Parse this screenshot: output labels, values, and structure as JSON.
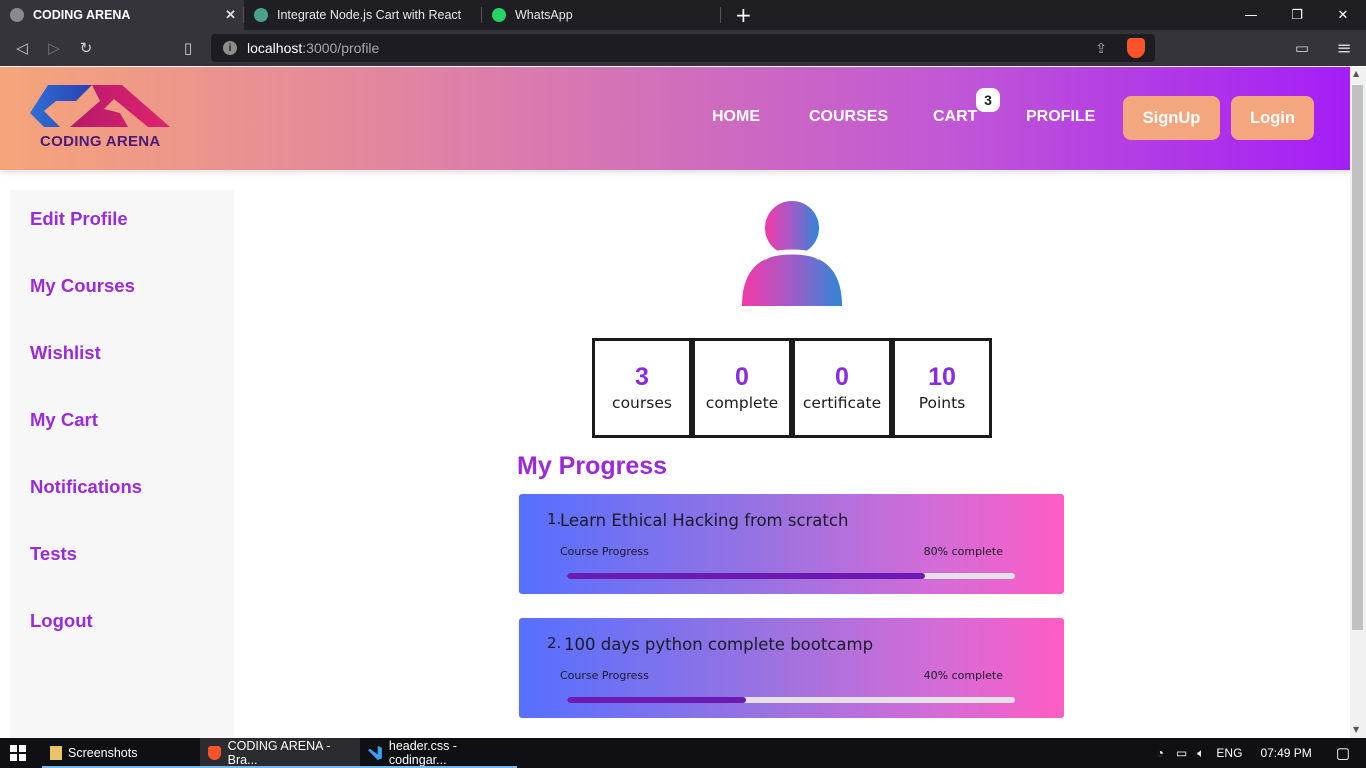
{
  "browser": {
    "tabs": [
      {
        "title": "CODING ARENA",
        "active": true
      },
      {
        "title": "Integrate Node.js Cart with React",
        "active": false
      },
      {
        "title": "WhatsApp",
        "active": false
      }
    ],
    "new_tab": "+",
    "url_host": "localhost",
    "url_path": ":3000/profile"
  },
  "header": {
    "logo_text": "CODING ARENA",
    "nav": {
      "home": "HOME",
      "courses": "COURSES",
      "cart": "CART",
      "cart_count": "3",
      "profile": "PROFILE"
    },
    "signup": "SignUp",
    "login": "Login"
  },
  "sidebar": {
    "items": [
      "Edit Profile",
      "My Courses",
      "Wishlist",
      "My Cart",
      "Notifications",
      "Tests",
      "Logout"
    ]
  },
  "stats": [
    {
      "value": "3",
      "label": "courses"
    },
    {
      "value": "0",
      "label": "complete"
    },
    {
      "value": "0",
      "label": "certificate"
    },
    {
      "value": "10",
      "label": "Points"
    }
  ],
  "progress": {
    "title": "My Progress",
    "courses": [
      {
        "index": "1.",
        "name": "Learn Ethical Hacking from scratch",
        "caption": "Course Progress",
        "percent_text": "80% complete",
        "fraction": 0.8
      },
      {
        "index": "2.",
        "name": "100 days python complete bootcamp",
        "caption": "Course Progress",
        "percent_text": "40% complete",
        "fraction": 0.4
      }
    ]
  },
  "taskbar": {
    "items": [
      "Screenshots",
      "CODING ARENA - Bra...",
      "header.css - codingar..."
    ],
    "lang": "ENG",
    "time": "07:49 PM"
  },
  "colors": {
    "accent": "#9a2bd6",
    "header_start": "#f6a57a",
    "header_end": "#a41ef6",
    "button": "#f4a67f"
  }
}
